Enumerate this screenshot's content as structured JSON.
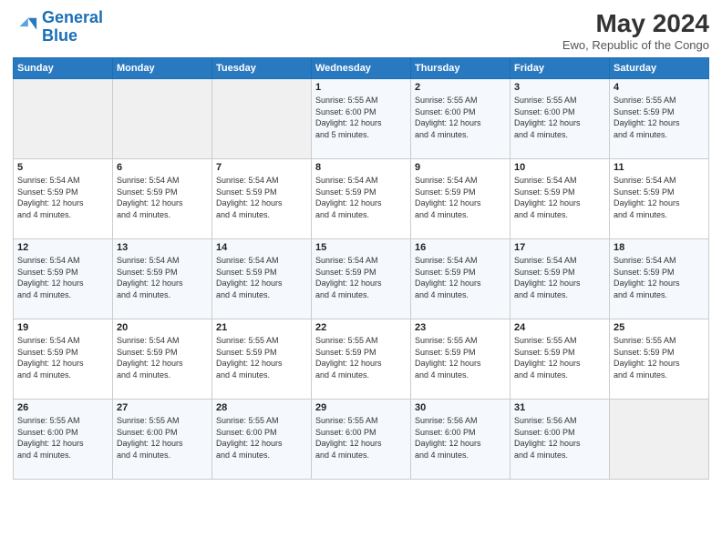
{
  "header": {
    "logo_line1": "General",
    "logo_line2": "Blue",
    "month": "May 2024",
    "location": "Ewo, Republic of the Congo"
  },
  "days_of_week": [
    "Sunday",
    "Monday",
    "Tuesday",
    "Wednesday",
    "Thursday",
    "Friday",
    "Saturday"
  ],
  "weeks": [
    [
      {
        "day": "",
        "info": ""
      },
      {
        "day": "",
        "info": ""
      },
      {
        "day": "",
        "info": ""
      },
      {
        "day": "1",
        "info": "Sunrise: 5:55 AM\nSunset: 6:00 PM\nDaylight: 12 hours\nand 5 minutes."
      },
      {
        "day": "2",
        "info": "Sunrise: 5:55 AM\nSunset: 6:00 PM\nDaylight: 12 hours\nand 4 minutes."
      },
      {
        "day": "3",
        "info": "Sunrise: 5:55 AM\nSunset: 6:00 PM\nDaylight: 12 hours\nand 4 minutes."
      },
      {
        "day": "4",
        "info": "Sunrise: 5:55 AM\nSunset: 5:59 PM\nDaylight: 12 hours\nand 4 minutes."
      }
    ],
    [
      {
        "day": "5",
        "info": "Sunrise: 5:54 AM\nSunset: 5:59 PM\nDaylight: 12 hours\nand 4 minutes."
      },
      {
        "day": "6",
        "info": "Sunrise: 5:54 AM\nSunset: 5:59 PM\nDaylight: 12 hours\nand 4 minutes."
      },
      {
        "day": "7",
        "info": "Sunrise: 5:54 AM\nSunset: 5:59 PM\nDaylight: 12 hours\nand 4 minutes."
      },
      {
        "day": "8",
        "info": "Sunrise: 5:54 AM\nSunset: 5:59 PM\nDaylight: 12 hours\nand 4 minutes."
      },
      {
        "day": "9",
        "info": "Sunrise: 5:54 AM\nSunset: 5:59 PM\nDaylight: 12 hours\nand 4 minutes."
      },
      {
        "day": "10",
        "info": "Sunrise: 5:54 AM\nSunset: 5:59 PM\nDaylight: 12 hours\nand 4 minutes."
      },
      {
        "day": "11",
        "info": "Sunrise: 5:54 AM\nSunset: 5:59 PM\nDaylight: 12 hours\nand 4 minutes."
      }
    ],
    [
      {
        "day": "12",
        "info": "Sunrise: 5:54 AM\nSunset: 5:59 PM\nDaylight: 12 hours\nand 4 minutes."
      },
      {
        "day": "13",
        "info": "Sunrise: 5:54 AM\nSunset: 5:59 PM\nDaylight: 12 hours\nand 4 minutes."
      },
      {
        "day": "14",
        "info": "Sunrise: 5:54 AM\nSunset: 5:59 PM\nDaylight: 12 hours\nand 4 minutes."
      },
      {
        "day": "15",
        "info": "Sunrise: 5:54 AM\nSunset: 5:59 PM\nDaylight: 12 hours\nand 4 minutes."
      },
      {
        "day": "16",
        "info": "Sunrise: 5:54 AM\nSunset: 5:59 PM\nDaylight: 12 hours\nand 4 minutes."
      },
      {
        "day": "17",
        "info": "Sunrise: 5:54 AM\nSunset: 5:59 PM\nDaylight: 12 hours\nand 4 minutes."
      },
      {
        "day": "18",
        "info": "Sunrise: 5:54 AM\nSunset: 5:59 PM\nDaylight: 12 hours\nand 4 minutes."
      }
    ],
    [
      {
        "day": "19",
        "info": "Sunrise: 5:54 AM\nSunset: 5:59 PM\nDaylight: 12 hours\nand 4 minutes."
      },
      {
        "day": "20",
        "info": "Sunrise: 5:54 AM\nSunset: 5:59 PM\nDaylight: 12 hours\nand 4 minutes."
      },
      {
        "day": "21",
        "info": "Sunrise: 5:55 AM\nSunset: 5:59 PM\nDaylight: 12 hours\nand 4 minutes."
      },
      {
        "day": "22",
        "info": "Sunrise: 5:55 AM\nSunset: 5:59 PM\nDaylight: 12 hours\nand 4 minutes."
      },
      {
        "day": "23",
        "info": "Sunrise: 5:55 AM\nSunset: 5:59 PM\nDaylight: 12 hours\nand 4 minutes."
      },
      {
        "day": "24",
        "info": "Sunrise: 5:55 AM\nSunset: 5:59 PM\nDaylight: 12 hours\nand 4 minutes."
      },
      {
        "day": "25",
        "info": "Sunrise: 5:55 AM\nSunset: 5:59 PM\nDaylight: 12 hours\nand 4 minutes."
      }
    ],
    [
      {
        "day": "26",
        "info": "Sunrise: 5:55 AM\nSunset: 6:00 PM\nDaylight: 12 hours\nand 4 minutes."
      },
      {
        "day": "27",
        "info": "Sunrise: 5:55 AM\nSunset: 6:00 PM\nDaylight: 12 hours\nand 4 minutes."
      },
      {
        "day": "28",
        "info": "Sunrise: 5:55 AM\nSunset: 6:00 PM\nDaylight: 12 hours\nand 4 minutes."
      },
      {
        "day": "29",
        "info": "Sunrise: 5:55 AM\nSunset: 6:00 PM\nDaylight: 12 hours\nand 4 minutes."
      },
      {
        "day": "30",
        "info": "Sunrise: 5:56 AM\nSunset: 6:00 PM\nDaylight: 12 hours\nand 4 minutes."
      },
      {
        "day": "31",
        "info": "Sunrise: 5:56 AM\nSunset: 6:00 PM\nDaylight: 12 hours\nand 4 minutes."
      },
      {
        "day": "",
        "info": ""
      }
    ]
  ]
}
